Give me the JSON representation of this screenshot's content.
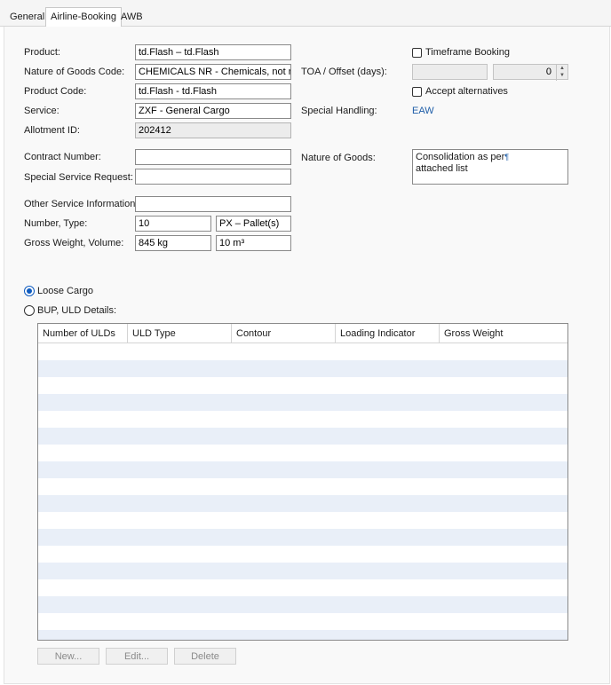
{
  "tabs": [
    {
      "label": "General"
    },
    {
      "label": "Airline-Booking"
    },
    {
      "label": "AWB"
    }
  ],
  "form": {
    "product": {
      "label": "Product:",
      "value": "td.Flash – td.Flash"
    },
    "nature_code": {
      "label": "Nature of Goods Code:",
      "value": "CHEMICALS NR - Chemicals, not restr"
    },
    "product_code": {
      "label": "Product Code:",
      "value": "td.Flash - td.Flash"
    },
    "service": {
      "label": "Service:",
      "value": "ZXF - General Cargo"
    },
    "allotment": {
      "label": "Allotment ID:",
      "value": "202412"
    },
    "contract": {
      "label": "Contract Number:",
      "value": ""
    },
    "ssr": {
      "label": "Special Service Request:",
      "value": ""
    },
    "osi": {
      "label": "Other Service Information:",
      "value": ""
    },
    "number_type": {
      "label": "Number, Type:",
      "number": "10",
      "type": "PX – Pallet(s)"
    },
    "gross": {
      "label": "Gross Weight, Volume:",
      "weight": "845 kg",
      "volume": "10 m³"
    }
  },
  "right": {
    "timeframe": {
      "label": "Timeframe Booking",
      "checked": false
    },
    "toa": {
      "label": "TOA / Offset (days):",
      "date": "",
      "offset": "0"
    },
    "accept_alt": {
      "label": "Accept alternatives",
      "checked": false
    },
    "special_handling": {
      "label": "Special Handling:",
      "value": "EAW"
    },
    "nature_goods": {
      "label": "Nature of Goods:",
      "line1": "Consolidation as per",
      "mark": "¶",
      "line2": "attached list"
    }
  },
  "cargo": {
    "loose": {
      "label": "Loose Cargo",
      "selected": true
    },
    "bup": {
      "label": "BUP, ULD Details:",
      "selected": false
    }
  },
  "grid": {
    "columns": [
      "Number of ULDs",
      "ULD Type",
      "Contour",
      "Loading Indicator",
      "Gross Weight"
    ],
    "rows": []
  },
  "buttons": {
    "new": "New...",
    "edit": "Edit...",
    "delete": "Delete"
  },
  "colors": {
    "accent": "#0f5bbf",
    "link": "#1f5ea8",
    "row_alt": "#e9eff8"
  }
}
